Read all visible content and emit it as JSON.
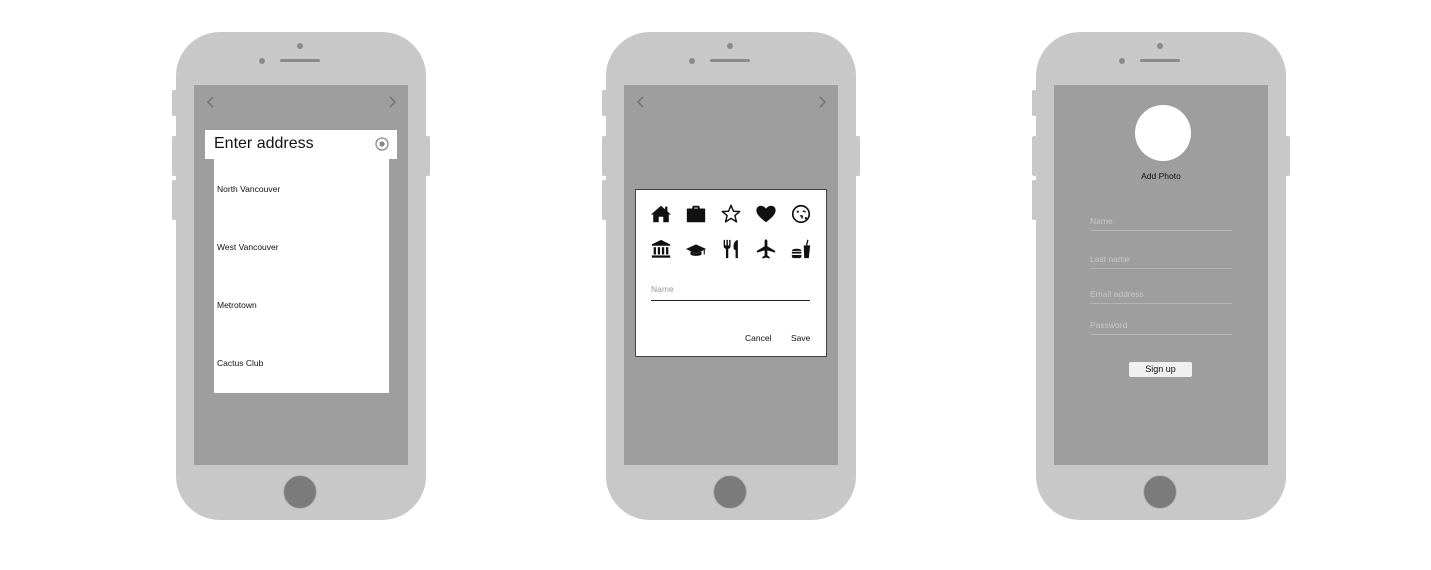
{
  "phone1": {
    "address_title": "Enter address",
    "results": [
      "North Vancouver",
      "West Vancouver",
      "Metrotown",
      "Cactus Club"
    ]
  },
  "phone2": {
    "icons": [
      "home-icon",
      "briefcase-icon",
      "star-icon",
      "heart-icon",
      "emoji-icon",
      "bank-icon",
      "graduation-cap-icon",
      "restaurant-icon",
      "airplane-icon",
      "fast-food-icon"
    ],
    "name_placeholder": "Name",
    "cancel_label": "Cancel",
    "save_label": "Save"
  },
  "phone3": {
    "add_photo_label": "Add Photo",
    "fields": [
      {
        "placeholder": "Name"
      },
      {
        "placeholder": "Last name"
      },
      {
        "placeholder": "Email address"
      },
      {
        "placeholder": "Password"
      }
    ],
    "signup_label": "Sign up"
  }
}
